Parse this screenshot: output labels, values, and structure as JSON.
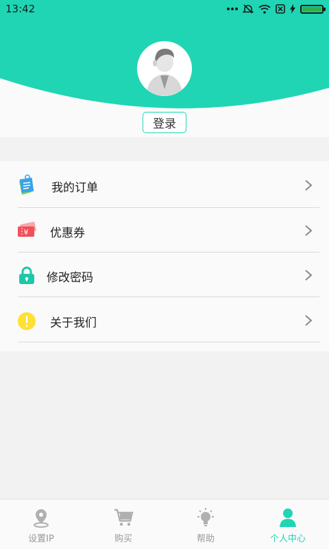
{
  "status_bar": {
    "time": "13:42",
    "battery_percent": 100
  },
  "header": {
    "login_label": "登录"
  },
  "menu": {
    "items": [
      {
        "label": "我的订单",
        "icon": "order-list-icon"
      },
      {
        "label": "优惠券",
        "icon": "coupon-icon"
      },
      {
        "label": "修改密码",
        "icon": "lock-icon"
      },
      {
        "label": "关于我们",
        "icon": "info-icon"
      }
    ]
  },
  "tab_bar": {
    "tabs": [
      {
        "label": "设置IP",
        "icon": "location-pin-icon",
        "active": false
      },
      {
        "label": "购买",
        "icon": "shopping-cart-icon",
        "active": false
      },
      {
        "label": "帮助",
        "icon": "lightbulb-icon",
        "active": false
      },
      {
        "label": "个人中心",
        "icon": "person-icon",
        "active": true
      }
    ]
  },
  "colors": {
    "accent": "#1fd5b4",
    "background": "#f2f2f2",
    "card": "#fafafa",
    "inactive_text": "#999999"
  }
}
